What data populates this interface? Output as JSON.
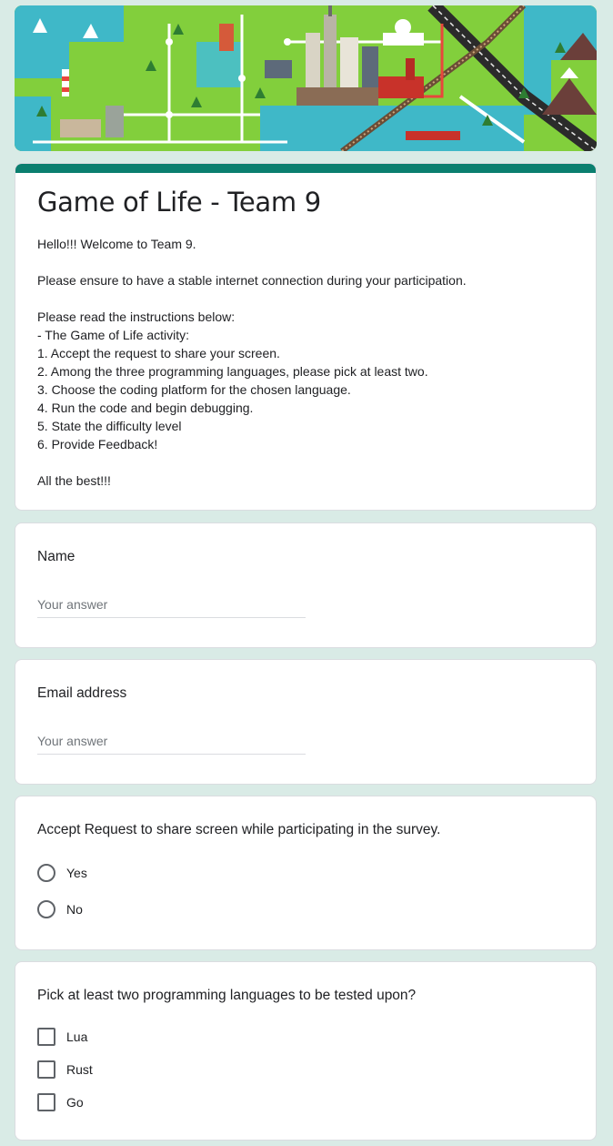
{
  "form": {
    "title": "Game of Life - Team 9",
    "description_lines": [
      "Hello!!! Welcome to Team 9.",
      "",
      "Please ensure to have a stable internet connection during your participation.",
      "",
      "Please read the instructions below:",
      "- The Game of Life activity:",
      "1. Accept the request to share your screen.",
      "2. Among the three programming languages, please pick at least two.",
      "3. Choose the coding platform for the chosen language.",
      "4. Run the code and begin debugging.",
      "5. State the difficulty level",
      "6. Provide Feedback!",
      "",
      "All the best!!!"
    ]
  },
  "questions": {
    "name": {
      "title": "Name",
      "placeholder": "Your answer",
      "value": ""
    },
    "email": {
      "title": "Email address",
      "placeholder": "Your answer",
      "value": ""
    },
    "share_screen": {
      "title": "Accept Request to share screen while participating in the survey.",
      "options": [
        "Yes",
        "No"
      ]
    },
    "languages": {
      "title": "Pick at least two programming languages to be tested upon?",
      "options": [
        "Lua",
        "Rust",
        "Go"
      ]
    }
  },
  "theme": {
    "background": "#d9ebe6",
    "accent": "#0b7f6f",
    "banner_base": "#7ccf3a"
  },
  "icons": {
    "banner": "city-map-illustration",
    "radio": "radio-unchecked-icon",
    "checkbox": "checkbox-unchecked-icon"
  }
}
